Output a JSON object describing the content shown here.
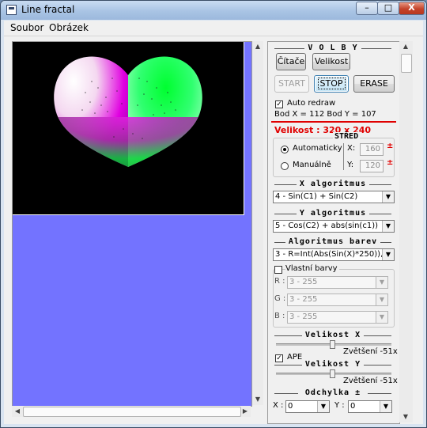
{
  "window": {
    "title": "Line fractal",
    "min_label": "–",
    "max_label": "□",
    "close_label": "X"
  },
  "menu": [
    "Soubor",
    "Obrázek"
  ],
  "panel": {
    "volby_title": "V O L B Y",
    "citace_btn": "Čítače",
    "velikost_btn": "Velikost",
    "start_btn": "START",
    "stop_btn": "STOP",
    "erase_btn": "ERASE",
    "auto_redraw_label": "Auto redraw",
    "auto_redraw_checked": true,
    "bod_text": "Bod X = 112   Bod Y = 107",
    "velikost_text": "Velikost : 320 x 240",
    "velikost_color": "#e00000",
    "stred_title": "STŘED",
    "auto_radio": "Automaticky",
    "manual_radio": "Manuálně",
    "x_label": "X:",
    "y_label": "Y:",
    "x_value": "160",
    "y_value": "120",
    "plusminus": "±",
    "x_alg_title": "X algoritmus",
    "x_alg_value": "4 - Sin(C1) + Sin(C2)",
    "y_alg_title": "Y algoritmus",
    "y_alg_value": "5 - Cos(C2) + abs(sin(c1))",
    "color_alg_title": "Algoritmus barev",
    "color_alg_value": "3 - R=Int(Abs(Sin(X)*250)), G=Int",
    "own_colors_label": "Vlastní barvy",
    "r_label": "R :",
    "g_label": "G :",
    "b_label": "B :",
    "r_value": "3 - 255",
    "g_value": "3 - 255",
    "b_value": "3 - 255",
    "vel_x_title": "Velikost X",
    "zoom_x": "Zvětšení -51x",
    "ape_label": "APE",
    "ape_checked": true,
    "vel_y_title": "Velikost Y",
    "zoom_y": "Zvětšení -51x",
    "odchylka_title": "Odchylka ±",
    "odch_x_label": "X :",
    "odch_y_label": "Y :",
    "odch_x_value": "0",
    "odch_y_value": "0"
  },
  "colors": {
    "canvas_bg": "#7373ff",
    "fractal_bg": "#000000",
    "accent_red": "#e00000"
  }
}
